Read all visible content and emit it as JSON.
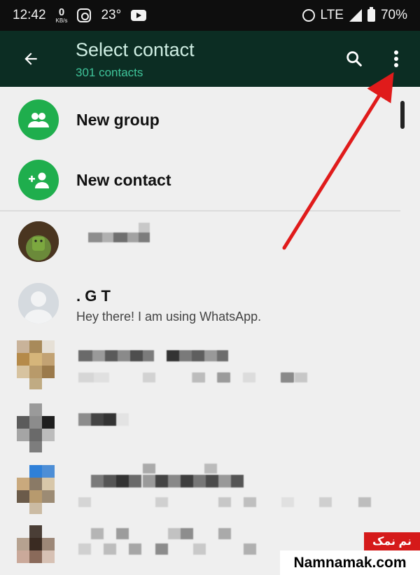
{
  "status_bar": {
    "time": "12:42",
    "net_speed": "0",
    "net_unit": "KB/s",
    "temperature": "23°",
    "network": "LTE",
    "battery": "70%"
  },
  "app_bar": {
    "title": "Select contact",
    "subtitle": "301 contacts",
    "icons": [
      "arrow-back-icon",
      "search-icon",
      "more-vert-icon"
    ]
  },
  "actions": [
    {
      "label": "New group",
      "icon": "group-icon"
    },
    {
      "label": "New contact",
      "icon": "person-add-icon"
    }
  ],
  "contacts": [
    {
      "name": "",
      "status": ""
    },
    {
      "name": ". G T",
      "status": "Hey there! I am using WhatsApp."
    },
    {
      "name": "",
      "status": ""
    },
    {
      "name": "",
      "status": ""
    },
    {
      "name": "",
      "status": ""
    },
    {
      "name": "",
      "status": ""
    }
  ],
  "watermark": {
    "persian": "نم نمک",
    "site": "Namnamak.com"
  },
  "colors": {
    "app_bar": "#0c2d23",
    "accent_green": "#1fae4d",
    "subtitle": "#3fc49a",
    "arrow": "#e01b1b"
  }
}
